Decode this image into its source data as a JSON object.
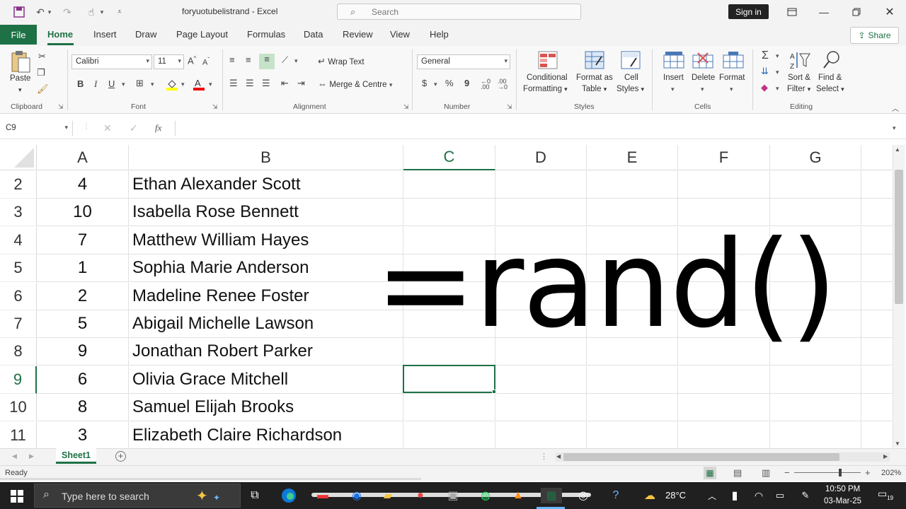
{
  "titlebar": {
    "doc_title": "foryuotubelistrand  -  Excel",
    "search_placeholder": "Search",
    "signin_label": "Sign in"
  },
  "tabs": {
    "file": "File",
    "items": [
      "Home",
      "Insert",
      "Draw",
      "Page Layout",
      "Formulas",
      "Data",
      "Review",
      "View",
      "Help"
    ],
    "share": "Share"
  },
  "ribbon": {
    "clipboard": {
      "label": "Clipboard",
      "paste": "Paste"
    },
    "font": {
      "label": "Font",
      "name": "Calibri",
      "size": "11",
      "bold": "B",
      "italic": "I",
      "underline": "U",
      "grow": "A",
      "shrink": "A"
    },
    "alignment": {
      "label": "Alignment",
      "wrap": "Wrap Text",
      "merge": "Merge & Centre"
    },
    "number": {
      "label": "Number",
      "format": "General",
      "currency": "$",
      "percent": "%",
      "comma": "9"
    },
    "styles": {
      "label": "Styles",
      "conditional": "Conditional",
      "conditional2": "Formatting",
      "format_table": "Format as",
      "format_table2": "Table",
      "cell_styles": "Cell",
      "cell_styles2": "Styles"
    },
    "cells": {
      "label": "Cells",
      "insert": "Insert",
      "delete": "Delete",
      "format": "Format"
    },
    "editing": {
      "label": "Editing",
      "sort": "Sort &",
      "sort2": "Filter",
      "find": "Find &",
      "find2": "Select"
    }
  },
  "formula_bar": {
    "name_box": "C9",
    "fx": "fx",
    "value": ""
  },
  "grid": {
    "columns": [
      "A",
      "B",
      "C",
      "D",
      "E",
      "F",
      "G"
    ],
    "rows": [
      {
        "row": "2",
        "a": "4",
        "b": "Ethan Alexander Scott"
      },
      {
        "row": "3",
        "a": "10",
        "b": "Isabella Rose Bennett"
      },
      {
        "row": "4",
        "a": "7",
        "b": "Matthew William Hayes"
      },
      {
        "row": "5",
        "a": "1",
        "b": "Sophia Marie Anderson"
      },
      {
        "row": "6",
        "a": "2",
        "b": "Madeline Renee Foster"
      },
      {
        "row": "7",
        "a": "5",
        "b": "Abigail Michelle Lawson"
      },
      {
        "row": "8",
        "a": "9",
        "b": "Jonathan Robert Parker"
      },
      {
        "row": "9",
        "a": "6",
        "b": "Olivia Grace Mitchell"
      },
      {
        "row": "10",
        "a": "8",
        "b": "Samuel Elijah Brooks"
      },
      {
        "row": "11",
        "a": "3",
        "b": "Elizabeth Claire Richardson"
      }
    ],
    "overlay_text": "=rand()"
  },
  "sheets": {
    "active": "Sheet1"
  },
  "status": {
    "ready": "Ready",
    "zoom": "202%"
  },
  "taskbar": {
    "search_placeholder": "Type here to search",
    "temperature": "28°C",
    "time": "10:50 PM",
    "date": "03-Mar-25",
    "notifications": "19"
  },
  "colors": {
    "accent": "#1e7145",
    "taskbar": "#202020"
  }
}
